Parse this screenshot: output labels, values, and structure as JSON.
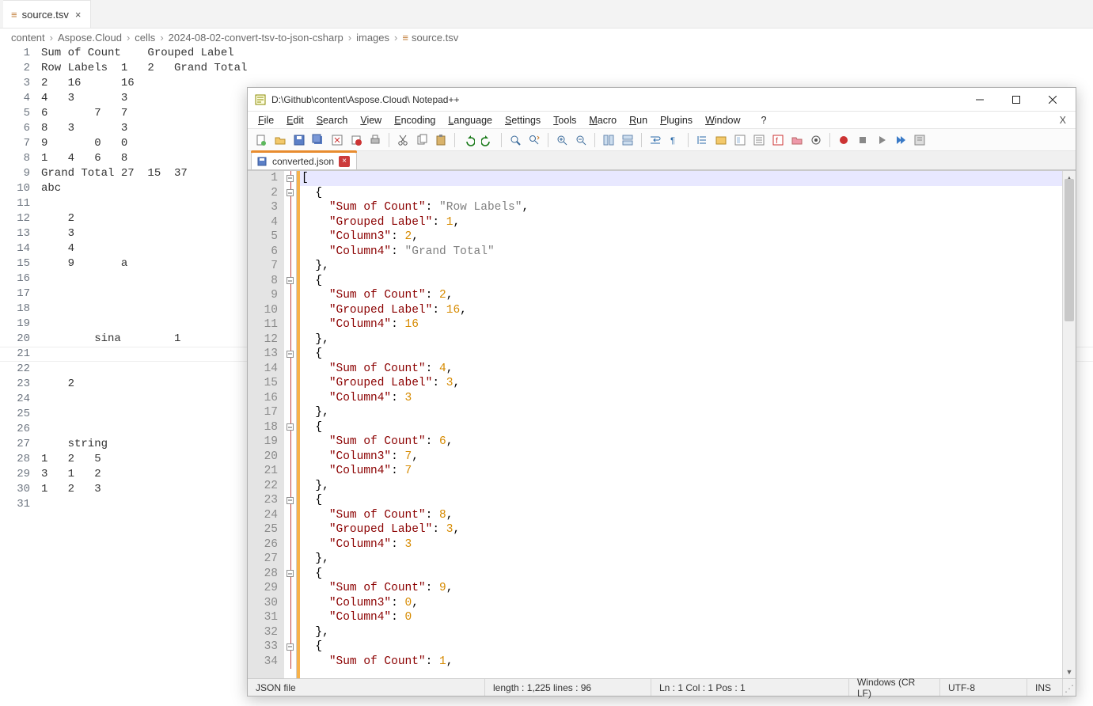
{
  "vscode": {
    "tab": {
      "label": "source.tsv",
      "close_glyph": "×"
    },
    "breadcrumb": [
      "content",
      "Aspose.Cloud",
      "cells",
      "2024-08-02-convert-tsv-to-json-csharp",
      "images",
      "source.tsv"
    ],
    "breadcrumb_sep": "›",
    "total_lines": 31,
    "cursor_line": 21,
    "rows": [
      "Sum of Count    Grouped Label",
      "Row Labels  1   2   Grand Total",
      "2   16      16",
      "4   3       3",
      "6       7   7",
      "8   3       3",
      "9       0   0",
      "1   4   6   8",
      "Grand Total 27  15  37",
      "abc",
      "",
      "    2",
      "    3",
      "    4",
      "    9       a",
      "",
      "",
      "",
      "",
      "        sina        1",
      "",
      "",
      "    2",
      "",
      "",
      "",
      "    string",
      "1   2   5",
      "3   1   2",
      "1   2   3",
      ""
    ]
  },
  "npp": {
    "title": "D:\\Github\\content\\Aspose.Cloud\\ Notepad++",
    "menus": [
      "File",
      "Edit",
      "Search",
      "View",
      "Encoding",
      "Language",
      "Settings",
      "Tools",
      "Macro",
      "Run",
      "Plugins",
      "Window",
      "?"
    ],
    "tab": {
      "label": "converted.json"
    },
    "status": {
      "filetype": "JSON file",
      "length": "length : 1,225   lines : 96",
      "pos": "Ln : 1   Col : 1   Pos : 1",
      "eol": "Windows (CR LF)",
      "encoding": "UTF-8",
      "mode": "INS"
    },
    "code": [
      {
        "fold": "box",
        "hl": true,
        "tokens": [
          {
            "t": "[",
            "c": "punc"
          }
        ]
      },
      {
        "fold": "box",
        "tokens": [
          {
            "t": "  {",
            "c": "punc"
          }
        ]
      },
      {
        "fold": "line",
        "tokens": [
          {
            "t": "    ",
            "c": "punc"
          },
          {
            "t": "\"Sum of Count\"",
            "c": "key"
          },
          {
            "t": ": ",
            "c": "punc"
          },
          {
            "t": "\"Row Labels\"",
            "c": "str"
          },
          {
            "t": ",",
            "c": "punc"
          }
        ]
      },
      {
        "fold": "line",
        "tokens": [
          {
            "t": "    ",
            "c": "punc"
          },
          {
            "t": "\"Grouped Label\"",
            "c": "key"
          },
          {
            "t": ": ",
            "c": "punc"
          },
          {
            "t": "1",
            "c": "num"
          },
          {
            "t": ",",
            "c": "punc"
          }
        ]
      },
      {
        "fold": "line",
        "tokens": [
          {
            "t": "    ",
            "c": "punc"
          },
          {
            "t": "\"Column3\"",
            "c": "key"
          },
          {
            "t": ": ",
            "c": "punc"
          },
          {
            "t": "2",
            "c": "num"
          },
          {
            "t": ",",
            "c": "punc"
          }
        ]
      },
      {
        "fold": "line",
        "tokens": [
          {
            "t": "    ",
            "c": "punc"
          },
          {
            "t": "\"Column4\"",
            "c": "key"
          },
          {
            "t": ": ",
            "c": "punc"
          },
          {
            "t": "\"Grand Total\"",
            "c": "str"
          }
        ]
      },
      {
        "fold": "line",
        "tokens": [
          {
            "t": "  },",
            "c": "punc"
          }
        ]
      },
      {
        "fold": "box",
        "tokens": [
          {
            "t": "  {",
            "c": "punc"
          }
        ]
      },
      {
        "fold": "line",
        "tokens": [
          {
            "t": "    ",
            "c": "punc"
          },
          {
            "t": "\"Sum of Count\"",
            "c": "key"
          },
          {
            "t": ": ",
            "c": "punc"
          },
          {
            "t": "2",
            "c": "num"
          },
          {
            "t": ",",
            "c": "punc"
          }
        ]
      },
      {
        "fold": "line",
        "tokens": [
          {
            "t": "    ",
            "c": "punc"
          },
          {
            "t": "\"Grouped Label\"",
            "c": "key"
          },
          {
            "t": ": ",
            "c": "punc"
          },
          {
            "t": "16",
            "c": "num"
          },
          {
            "t": ",",
            "c": "punc"
          }
        ]
      },
      {
        "fold": "line",
        "tokens": [
          {
            "t": "    ",
            "c": "punc"
          },
          {
            "t": "\"Column4\"",
            "c": "key"
          },
          {
            "t": ": ",
            "c": "punc"
          },
          {
            "t": "16",
            "c": "num"
          }
        ]
      },
      {
        "fold": "line",
        "tokens": [
          {
            "t": "  },",
            "c": "punc"
          }
        ]
      },
      {
        "fold": "box",
        "tokens": [
          {
            "t": "  {",
            "c": "punc"
          }
        ]
      },
      {
        "fold": "line",
        "tokens": [
          {
            "t": "    ",
            "c": "punc"
          },
          {
            "t": "\"Sum of Count\"",
            "c": "key"
          },
          {
            "t": ": ",
            "c": "punc"
          },
          {
            "t": "4",
            "c": "num"
          },
          {
            "t": ",",
            "c": "punc"
          }
        ]
      },
      {
        "fold": "line",
        "tokens": [
          {
            "t": "    ",
            "c": "punc"
          },
          {
            "t": "\"Grouped Label\"",
            "c": "key"
          },
          {
            "t": ": ",
            "c": "punc"
          },
          {
            "t": "3",
            "c": "num"
          },
          {
            "t": ",",
            "c": "punc"
          }
        ]
      },
      {
        "fold": "line",
        "tokens": [
          {
            "t": "    ",
            "c": "punc"
          },
          {
            "t": "\"Column4\"",
            "c": "key"
          },
          {
            "t": ": ",
            "c": "punc"
          },
          {
            "t": "3",
            "c": "num"
          }
        ]
      },
      {
        "fold": "line",
        "tokens": [
          {
            "t": "  },",
            "c": "punc"
          }
        ]
      },
      {
        "fold": "box",
        "tokens": [
          {
            "t": "  {",
            "c": "punc"
          }
        ]
      },
      {
        "fold": "line",
        "tokens": [
          {
            "t": "    ",
            "c": "punc"
          },
          {
            "t": "\"Sum of Count\"",
            "c": "key"
          },
          {
            "t": ": ",
            "c": "punc"
          },
          {
            "t": "6",
            "c": "num"
          },
          {
            "t": ",",
            "c": "punc"
          }
        ]
      },
      {
        "fold": "line",
        "tokens": [
          {
            "t": "    ",
            "c": "punc"
          },
          {
            "t": "\"Column3\"",
            "c": "key"
          },
          {
            "t": ": ",
            "c": "punc"
          },
          {
            "t": "7",
            "c": "num"
          },
          {
            "t": ",",
            "c": "punc"
          }
        ]
      },
      {
        "fold": "line",
        "tokens": [
          {
            "t": "    ",
            "c": "punc"
          },
          {
            "t": "\"Column4\"",
            "c": "key"
          },
          {
            "t": ": ",
            "c": "punc"
          },
          {
            "t": "7",
            "c": "num"
          }
        ]
      },
      {
        "fold": "line",
        "tokens": [
          {
            "t": "  },",
            "c": "punc"
          }
        ]
      },
      {
        "fold": "box",
        "tokens": [
          {
            "t": "  {",
            "c": "punc"
          }
        ]
      },
      {
        "fold": "line",
        "tokens": [
          {
            "t": "    ",
            "c": "punc"
          },
          {
            "t": "\"Sum of Count\"",
            "c": "key"
          },
          {
            "t": ": ",
            "c": "punc"
          },
          {
            "t": "8",
            "c": "num"
          },
          {
            "t": ",",
            "c": "punc"
          }
        ]
      },
      {
        "fold": "line",
        "tokens": [
          {
            "t": "    ",
            "c": "punc"
          },
          {
            "t": "\"Grouped Label\"",
            "c": "key"
          },
          {
            "t": ": ",
            "c": "punc"
          },
          {
            "t": "3",
            "c": "num"
          },
          {
            "t": ",",
            "c": "punc"
          }
        ]
      },
      {
        "fold": "line",
        "tokens": [
          {
            "t": "    ",
            "c": "punc"
          },
          {
            "t": "\"Column4\"",
            "c": "key"
          },
          {
            "t": ": ",
            "c": "punc"
          },
          {
            "t": "3",
            "c": "num"
          }
        ]
      },
      {
        "fold": "line",
        "tokens": [
          {
            "t": "  },",
            "c": "punc"
          }
        ]
      },
      {
        "fold": "box",
        "tokens": [
          {
            "t": "  {",
            "c": "punc"
          }
        ]
      },
      {
        "fold": "line",
        "tokens": [
          {
            "t": "    ",
            "c": "punc"
          },
          {
            "t": "\"Sum of Count\"",
            "c": "key"
          },
          {
            "t": ": ",
            "c": "punc"
          },
          {
            "t": "9",
            "c": "num"
          },
          {
            "t": ",",
            "c": "punc"
          }
        ]
      },
      {
        "fold": "line",
        "tokens": [
          {
            "t": "    ",
            "c": "punc"
          },
          {
            "t": "\"Column3\"",
            "c": "key"
          },
          {
            "t": ": ",
            "c": "punc"
          },
          {
            "t": "0",
            "c": "num"
          },
          {
            "t": ",",
            "c": "punc"
          }
        ]
      },
      {
        "fold": "line",
        "tokens": [
          {
            "t": "    ",
            "c": "punc"
          },
          {
            "t": "\"Column4\"",
            "c": "key"
          },
          {
            "t": ": ",
            "c": "punc"
          },
          {
            "t": "0",
            "c": "num"
          }
        ]
      },
      {
        "fold": "line",
        "tokens": [
          {
            "t": "  },",
            "c": "punc"
          }
        ]
      },
      {
        "fold": "box",
        "tokens": [
          {
            "t": "  {",
            "c": "punc"
          }
        ]
      },
      {
        "fold": "line",
        "tokens": [
          {
            "t": "    ",
            "c": "punc"
          },
          {
            "t": "\"Sum of Count\"",
            "c": "key"
          },
          {
            "t": ": ",
            "c": "punc"
          },
          {
            "t": "1",
            "c": "num"
          },
          {
            "t": ",",
            "c": "punc"
          }
        ]
      }
    ]
  }
}
